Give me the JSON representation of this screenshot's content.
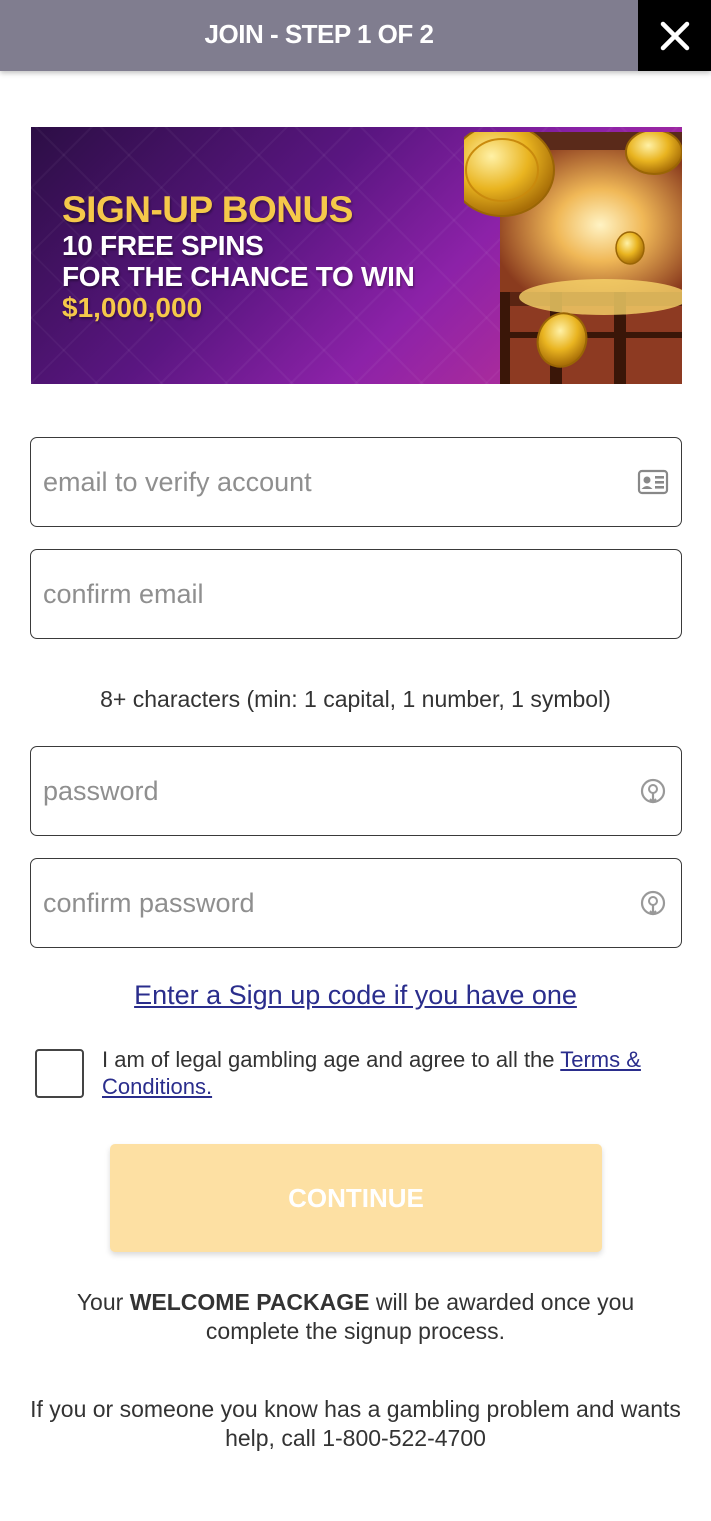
{
  "header": {
    "title": "JOIN - STEP 1 OF 2",
    "close_icon": "close-icon"
  },
  "banner": {
    "headline": "SIGN-UP BONUS",
    "line1": "10 FREE SPINS",
    "line2": "FOR THE CHANCE TO WIN",
    "amount": "$1,000,000",
    "colors": {
      "headline": "#f5c84a",
      "background": "#7a1d9b"
    }
  },
  "form": {
    "email_placeholder": "email to verify account",
    "email_icon": "contact-card-icon",
    "confirm_email_placeholder": "confirm email",
    "password_hint": "8+ characters (min: 1 capital, 1 number, 1 symbol)",
    "password_placeholder": "password",
    "confirm_password_placeholder": "confirm password",
    "password_icon": "show-password-icon",
    "signup_code_link": "Enter a Sign up code if you have one",
    "terms_prefix": "I am of legal gambling age and agree to all the",
    "terms_link": "Terms & Conditions.",
    "continue_label": "CONTINUE"
  },
  "footer": {
    "welcome_prefix": "Your ",
    "welcome_bold": "WELCOME PACKAGE",
    "welcome_suffix": " will be awarded once you complete the signup process.",
    "help_text": "If you or someone you know has a gambling problem and wants help, call 1-800-522-4700"
  }
}
